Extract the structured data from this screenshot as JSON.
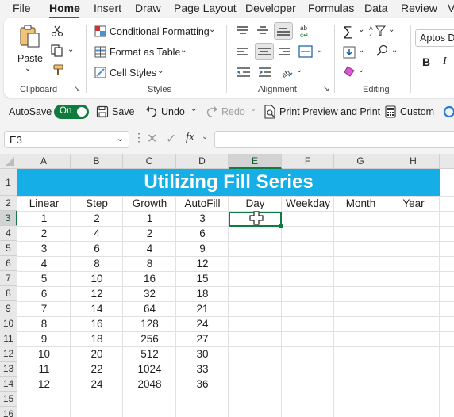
{
  "menu": {
    "tabs": [
      "File",
      "Home",
      "Insert",
      "Draw",
      "Page Layout",
      "Developer",
      "Formulas",
      "Data",
      "Review",
      "V"
    ],
    "active": "Home"
  },
  "ribbon": {
    "clipboard": {
      "paste": "Paste",
      "label": "Clipboard"
    },
    "styles": {
      "conditional": "Conditional Formatting",
      "format_table": "Format as Table",
      "cell_styles": "Cell Styles",
      "label": "Styles"
    },
    "alignment": {
      "label": "Alignment"
    },
    "editing": {
      "label": "Editing"
    },
    "font": {
      "name": "Aptos Di",
      "bold": "B",
      "italic": "I"
    }
  },
  "qat": {
    "autosave": "AutoSave",
    "toggle": "On",
    "save": "Save",
    "undo": "Undo",
    "redo": "Redo",
    "print": "Print Preview and Print",
    "custom": "Custom"
  },
  "formula_bar": {
    "name_box": "E3",
    "fx": "fx",
    "formula": ""
  },
  "sheet": {
    "title": "Utilizing Fill Series",
    "columns": [
      "A",
      "B",
      "C",
      "D",
      "E",
      "F",
      "G",
      "H"
    ],
    "rows": [
      "1",
      "2",
      "3",
      "4",
      "5",
      "6",
      "7",
      "8",
      "9",
      "10",
      "11",
      "12",
      "13",
      "14",
      "15",
      "16"
    ],
    "headers": [
      "Linear",
      "Step",
      "Growth",
      "AutoFill",
      "Day",
      "Weekday",
      "Month",
      "Year"
    ],
    "data": [
      [
        "1",
        "2",
        "1",
        "3"
      ],
      [
        "2",
        "4",
        "2",
        "6"
      ],
      [
        "3",
        "6",
        "4",
        "9"
      ],
      [
        "4",
        "8",
        "8",
        "12"
      ],
      [
        "5",
        "10",
        "16",
        "15"
      ],
      [
        "6",
        "12",
        "32",
        "18"
      ],
      [
        "7",
        "14",
        "64",
        "21"
      ],
      [
        "8",
        "16",
        "128",
        "24"
      ],
      [
        "9",
        "18",
        "256",
        "27"
      ],
      [
        "10",
        "20",
        "512",
        "30"
      ],
      [
        "11",
        "22",
        "1024",
        "33"
      ],
      [
        "12",
        "24",
        "2048",
        "36"
      ]
    ],
    "selected_cell": "E3",
    "title_color": "#15aee6",
    "accent": "#107c41"
  }
}
